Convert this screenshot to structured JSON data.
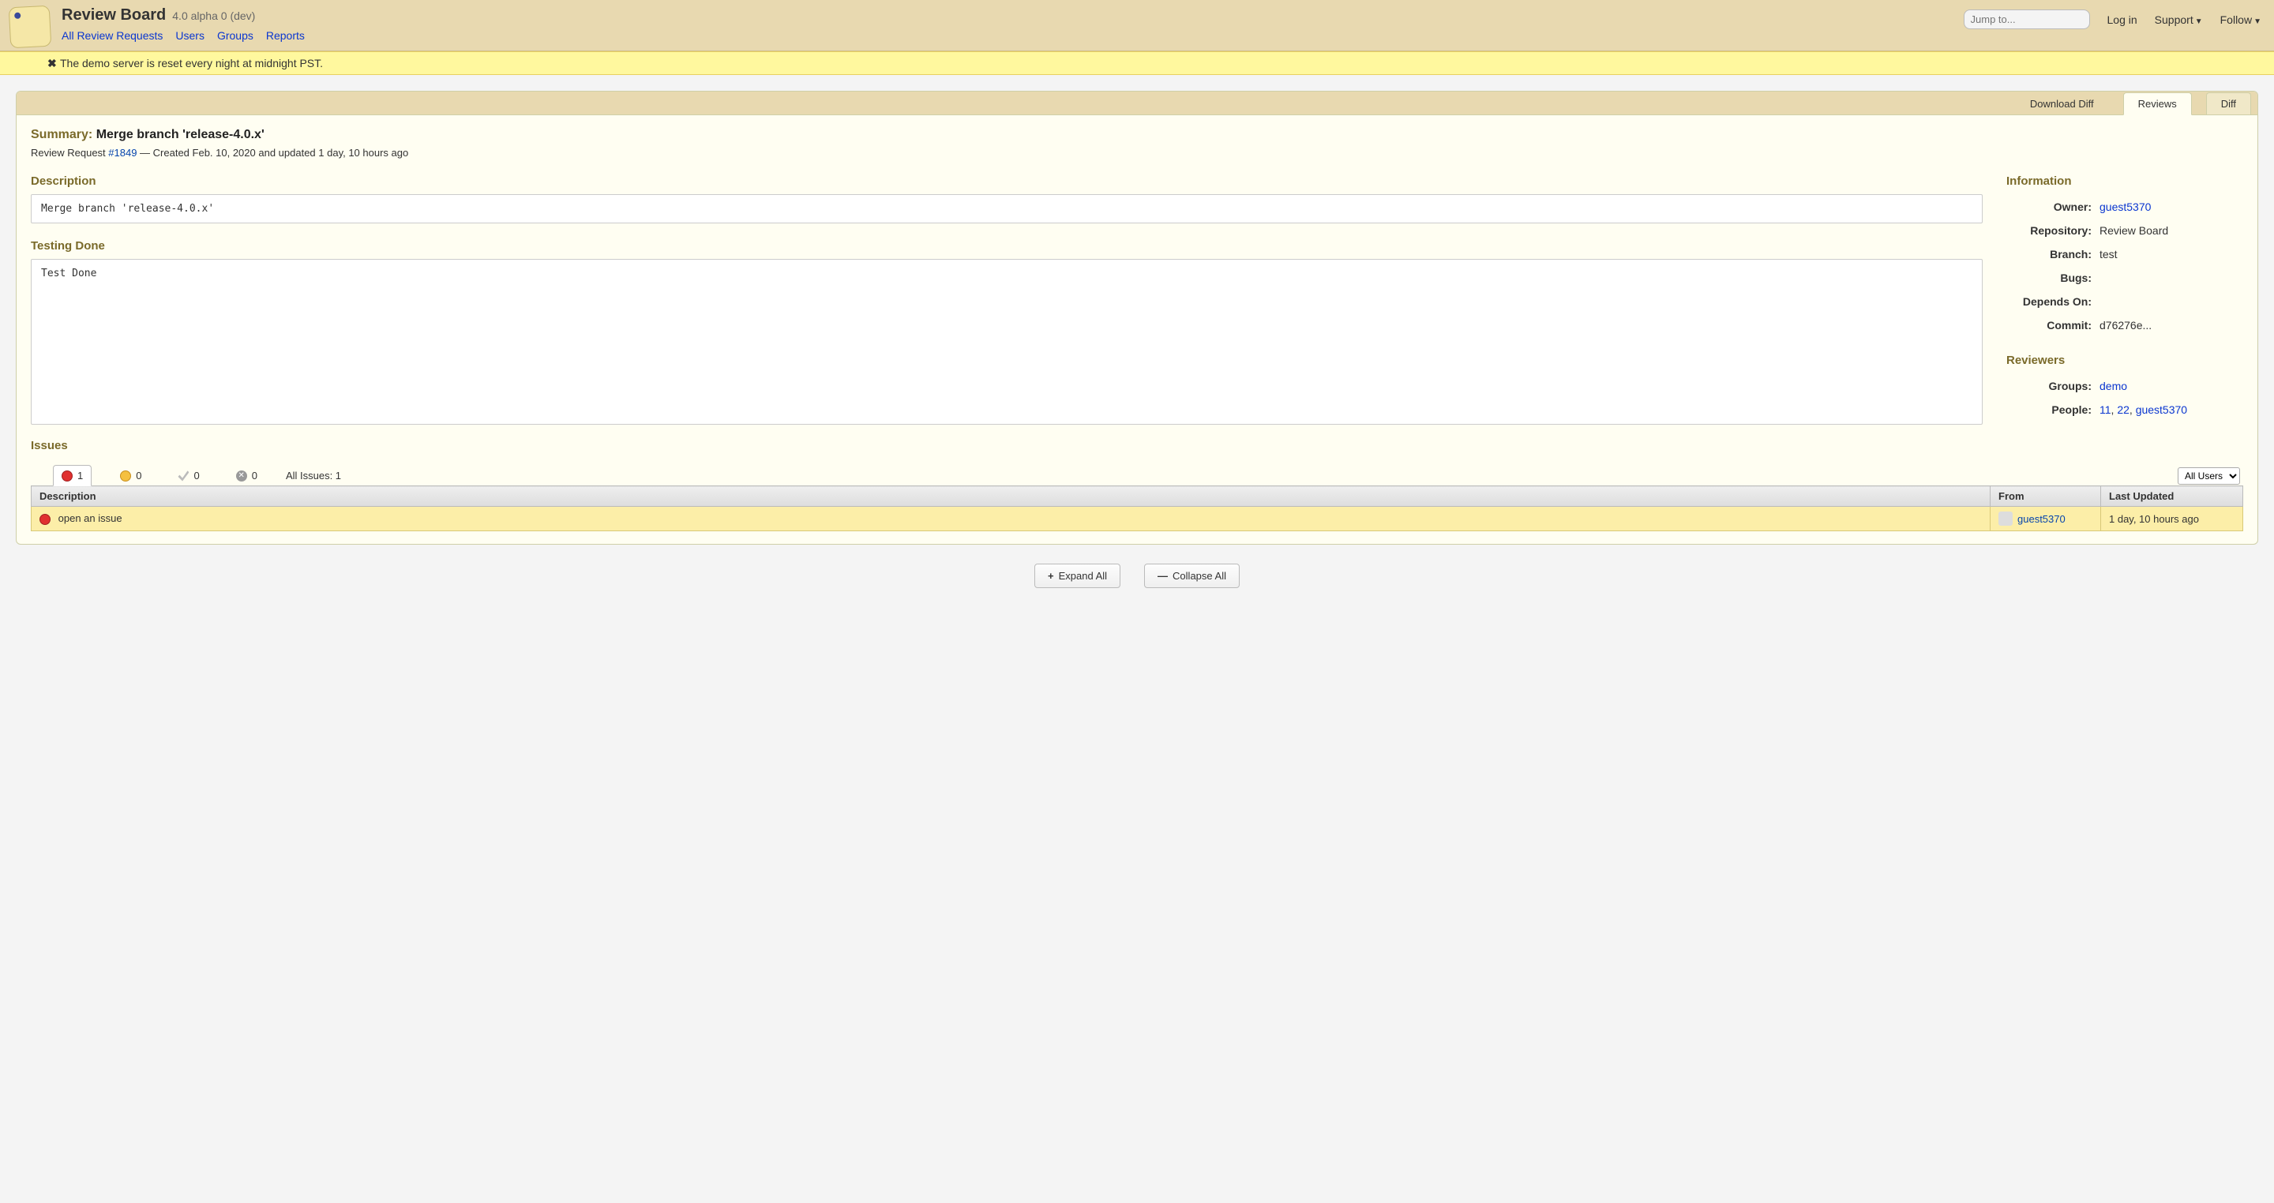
{
  "brand": {
    "title": "Review Board",
    "version": "4.0 alpha 0 (dev)"
  },
  "nav": {
    "all_requests": "All Review Requests",
    "users": "Users",
    "groups": "Groups",
    "reports": "Reports"
  },
  "header_right": {
    "search_placeholder": "Jump to...",
    "login": "Log in",
    "support": "Support",
    "follow": "Follow"
  },
  "alert": {
    "message": "The demo server is reset every night at midnight PST."
  },
  "tabs": {
    "download_diff": "Download Diff",
    "reviews": "Reviews",
    "diff": "Diff"
  },
  "summary": {
    "label": "Summary:",
    "value": "Merge branch 'release-4.0.x'"
  },
  "meta": {
    "prefix": "Review Request ",
    "id_link": "#1849",
    "suffix": " — Created Feb. 10, 2020 and updated 1 day, 10 hours ago"
  },
  "description": {
    "title": "Description",
    "content": "Merge branch 'release-4.0.x'"
  },
  "testing": {
    "title": "Testing Done",
    "content": "Test Done"
  },
  "info": {
    "title": "Information",
    "owner_label": "Owner:",
    "owner": "guest5370",
    "repository_label": "Repository:",
    "repository": "Review Board",
    "branch_label": "Branch:",
    "branch": "test",
    "bugs_label": "Bugs:",
    "bugs": "",
    "depends_label": "Depends On:",
    "depends": "",
    "commit_label": "Commit:",
    "commit": "d76276e..."
  },
  "reviewers": {
    "title": "Reviewers",
    "groups_label": "Groups:",
    "groups": "demo",
    "people_label": "People:",
    "people": {
      "p1": "11",
      "p2": "22",
      "p3": "guest5370"
    }
  },
  "issues": {
    "title": "Issues",
    "open_count": "1",
    "pending_count": "0",
    "resolved_count": "0",
    "dropped_count": "0",
    "all_label": "All Issues: 1",
    "user_filter": "All Users",
    "columns": {
      "description": "Description",
      "from": "From",
      "updated": "Last Updated"
    },
    "row": {
      "description": "open an issue",
      "from": "guest5370",
      "updated": "1 day, 10 hours ago"
    }
  },
  "actions": {
    "expand": "Expand All",
    "collapse": "Collapse All"
  }
}
